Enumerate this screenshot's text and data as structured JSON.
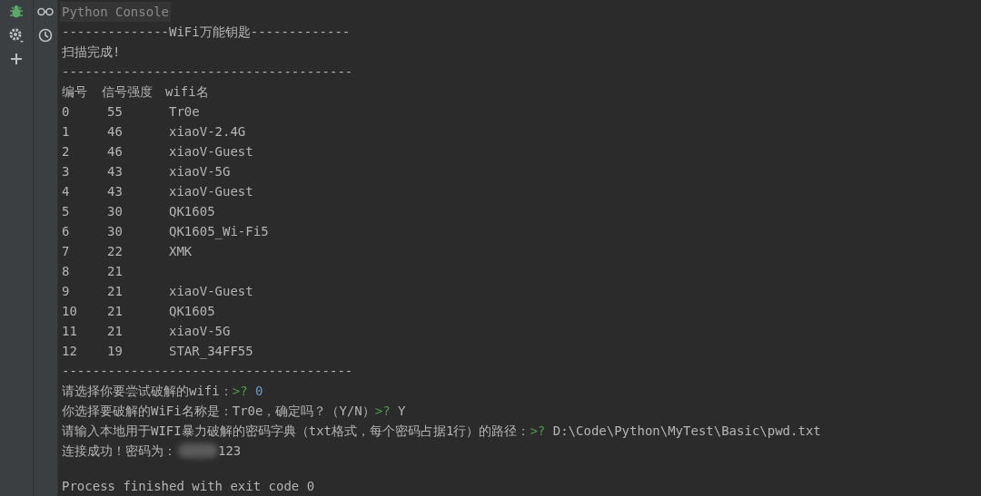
{
  "tool_strip": {
    "items": [
      {
        "kind": "bug"
      },
      {
        "kind": "gear"
      },
      {
        "kind": "plus"
      }
    ]
  },
  "side_strip": {
    "items": [
      {
        "kind": "glasses"
      },
      {
        "kind": "clock"
      }
    ]
  },
  "console": {
    "title": "Python Console",
    "lines": [
      {
        "kind": "text",
        "text": "--------------WiFi万能钥匙-------------"
      },
      {
        "kind": "text",
        "text": "扫描完成!"
      },
      {
        "kind": "text",
        "text": "--------------------------------------"
      }
    ],
    "table": {
      "columns": [
        "编号",
        "信号强度",
        "wifi名"
      ],
      "rows": [
        {
          "number": "0",
          "strength": "55",
          "name": "Tr0e"
        },
        {
          "number": "1",
          "strength": "46",
          "name": "xiaoV-2.4G"
        },
        {
          "number": "2",
          "strength": "46",
          "name": "xiaoV-Guest"
        },
        {
          "number": "3",
          "strength": "43",
          "name": "xiaoV-5G"
        },
        {
          "number": "4",
          "strength": "43",
          "name": "xiaoV-Guest"
        },
        {
          "number": "5",
          "strength": "30",
          "name": "QK1605"
        },
        {
          "number": "6",
          "strength": "30",
          "name": "QK1605_Wi-Fi5"
        },
        {
          "number": "7",
          "strength": "22",
          "name": "XMK"
        },
        {
          "number": "8",
          "strength": "21"
        },
        {
          "number": "9",
          "strength": "21",
          "name": "xiaoV-Guest"
        },
        {
          "number": "10",
          "strength": "21",
          "name": "QK1605"
        },
        {
          "number": "11",
          "strength": "21",
          "name": "xiaoV-5G"
        },
        {
          "number": "12",
          "strength": "19",
          "name": "STAR_34FF55"
        }
      ]
    },
    "after": [
      {
        "kind": "text",
        "text": "--------------------------------------"
      },
      {
        "kind": "prompt",
        "text": "请选择你要尝试破解的wifi：",
        "prompt": ">?",
        "input": "0",
        "input_highlighted": true
      },
      {
        "kind": "prompt",
        "text": "你选择要破解的WiFi名称是：Tr0e，确定吗？（Y/N）",
        "prompt": ">?",
        "input": "Y",
        "input_highlighted": false
      },
      {
        "kind": "prompt",
        "text": "请输入本地用于WIFI暴力破解的密码字典（txt格式，每个密码占据1行）的路径：",
        "prompt": ">?",
        "input": "D:\\Code\\Python\\MyTest\\Basic\\pwd.txt",
        "input_highlighted": false
      },
      {
        "kind": "redacted",
        "text": "连接成功！密码为：",
        "tail": "123"
      },
      {
        "kind": "blank"
      },
      {
        "kind": "text",
        "text": "Process finished with exit code 0"
      }
    ]
  }
}
